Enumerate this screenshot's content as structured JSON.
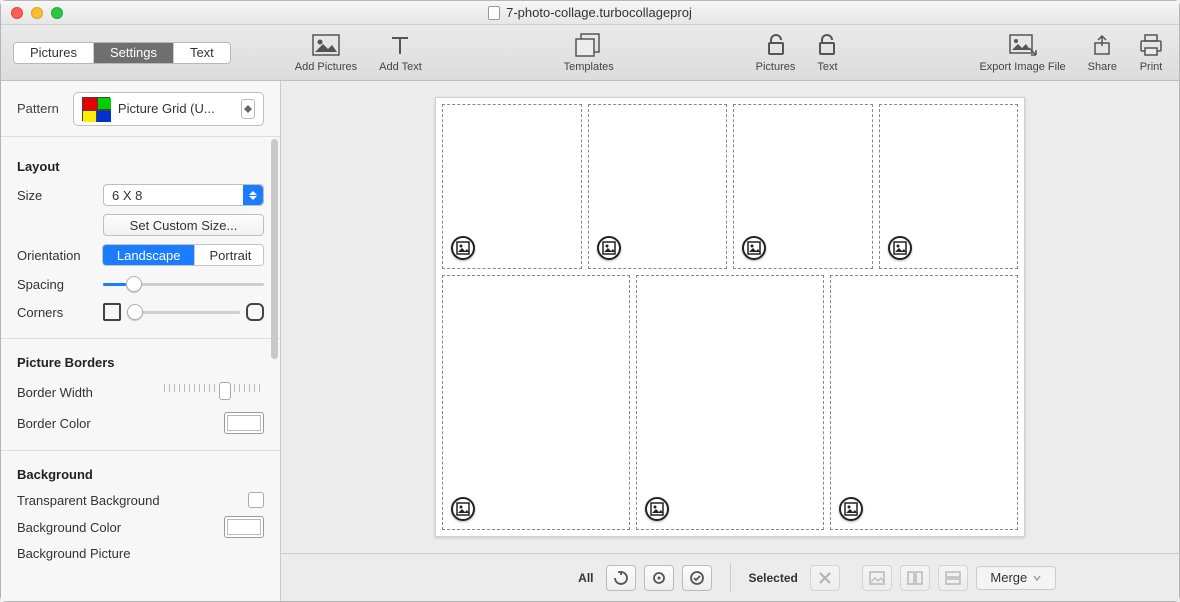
{
  "titlebar": {
    "filename": "7-photo-collage.turbocollageproj"
  },
  "topTabs": {
    "pictures": "Pictures",
    "settings": "Settings",
    "text": "Text",
    "active": "Settings"
  },
  "toolbar": {
    "addPictures": "Add Pictures",
    "addText": "Add Text",
    "templates": "Templates",
    "lockPictures": "Pictures",
    "lockText": "Text",
    "exportImage": "Export Image File",
    "share": "Share",
    "print": "Print"
  },
  "pattern": {
    "label": "Pattern",
    "value": "Picture Grid (U..."
  },
  "layout": {
    "heading": "Layout",
    "sizeLabel": "Size",
    "sizeValue": "6 X 8",
    "customSize": "Set Custom Size...",
    "orientationLabel": "Orientation",
    "landscape": "Landscape",
    "portrait": "Portrait",
    "spacingLabel": "Spacing",
    "cornersLabel": "Corners"
  },
  "pictureBorders": {
    "heading": "Picture Borders",
    "widthLabel": "Border Width",
    "colorLabel": "Border Color"
  },
  "background": {
    "heading": "Background",
    "transparent": "Transparent Background",
    "colorLabel": "Background Color",
    "pictureLabel": "Background Picture"
  },
  "bottombar": {
    "allLabel": "All",
    "selectedLabel": "Selected",
    "merge": "Merge"
  }
}
